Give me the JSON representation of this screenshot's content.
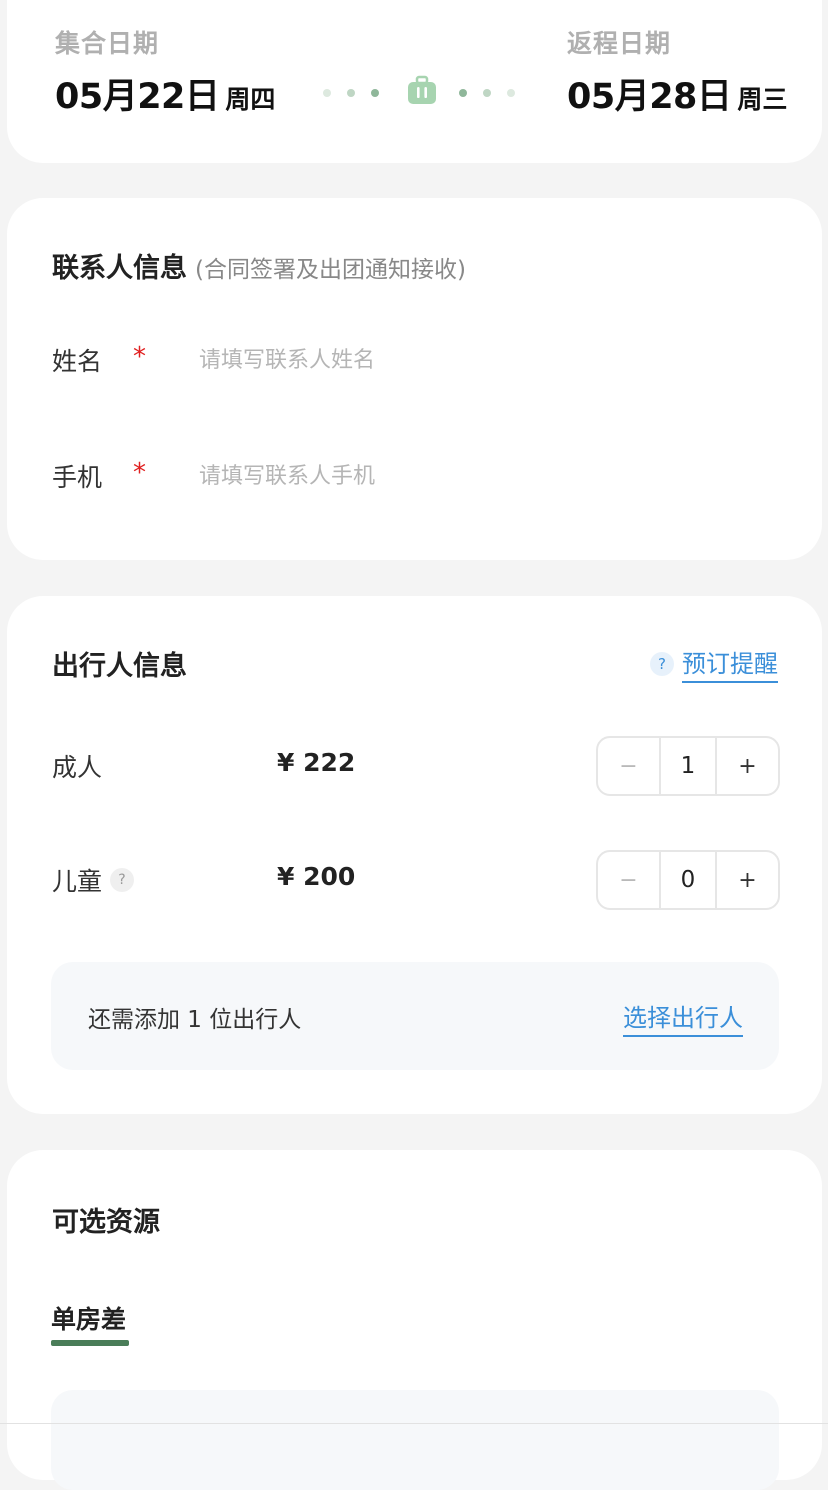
{
  "trip": {
    "depart_label": "集合日期",
    "depart_date": "05月22日",
    "depart_weekday": "周四",
    "return_label": "返程日期",
    "return_date": "05月28日",
    "return_weekday": "周三",
    "connector_icon": "suitcase-icon"
  },
  "contact": {
    "title": "联系人信息",
    "subtitle": "(合同签署及出团通知接收)",
    "required_mark": "*",
    "name": {
      "label": "姓名",
      "placeholder": "请填写联系人姓名",
      "value": ""
    },
    "phone": {
      "label": "手机",
      "placeholder": "请填写联系人手机",
      "value": ""
    }
  },
  "travelers": {
    "title": "出行人信息",
    "remind_icon": "?",
    "remind_label": "预订提醒",
    "adult": {
      "label": "成人",
      "price": "¥ 222",
      "count": "1"
    },
    "child": {
      "label": "儿童",
      "help_icon": "?",
      "price": "¥ 200",
      "count": "0"
    },
    "stepper": {
      "minus": "−",
      "plus": "+"
    },
    "notice_text": "还需添加 1 位出行人",
    "select_label": "选择出行人"
  },
  "resources": {
    "title": "可选资源",
    "tabs": [
      {
        "label": "单房差",
        "active": true
      }
    ]
  },
  "colors": {
    "accent_green": "#4a7d58",
    "link_blue": "#3b8fd9",
    "required_red": "#e02020"
  }
}
